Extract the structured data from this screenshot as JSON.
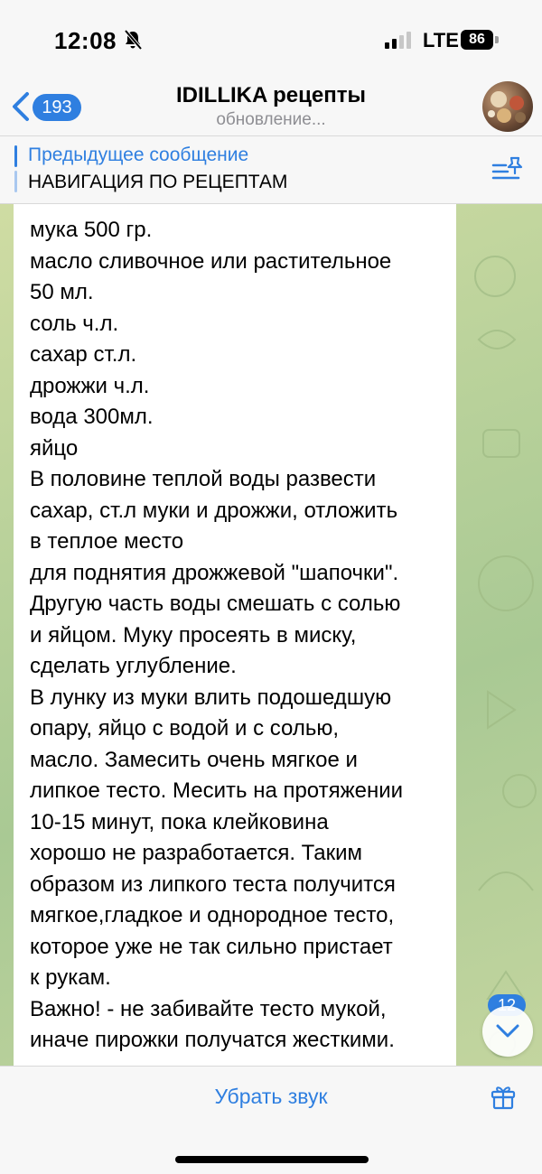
{
  "status_bar": {
    "time": "12:08",
    "network": "LTE",
    "battery": "86"
  },
  "header": {
    "back_count": "193",
    "title": "IDILLIKA рецепты",
    "subtitle": "обновление..."
  },
  "pinned": {
    "title": "Предыдущее сообщение",
    "text": "НАВИГАЦИЯ ПО РЕЦЕПТАМ"
  },
  "message": {
    "lines": [
      "мука 500 гр.",
      "масло сливочное или растительное",
      "50 мл.",
      "соль ч.л.",
      "сахар ст.л.",
      "дрожжи ч.л.",
      "вода 300мл.",
      "яйцо",
      "В половине теплой воды развести",
      "сахар, ст.л муки и дрожжи, отложить",
      "в теплое место",
      "для поднятия дрожжевой \"шапочки\".",
      "Другую часть воды смешать с солью",
      "и яйцом. Муку просеять в миску,",
      "сделать углубление.",
      "В лунку из муки влить подошедшую",
      "опару, яйцо с водой и с солью,",
      "масло. Замесить очень мягкое и",
      "липкое тесто. Месить на протяжении",
      "10-15 минут, пока клейковина",
      "хорошо не разработается. Таким",
      "образом из липкого теста получится",
      "мягкое,гладкое и однородное тесто,",
      "которое уже не так сильно пристает",
      "к рукам.",
      "Важно! - не забивайте тесто мукой,",
      "иначе пирожки получатся жесткими."
    ]
  },
  "scroll": {
    "unread_count": "12"
  },
  "bottom_bar": {
    "mute_label": "Убрать звук"
  },
  "colors": {
    "accent": "#2f7fe0",
    "chat_background": "#b8d19a"
  }
}
